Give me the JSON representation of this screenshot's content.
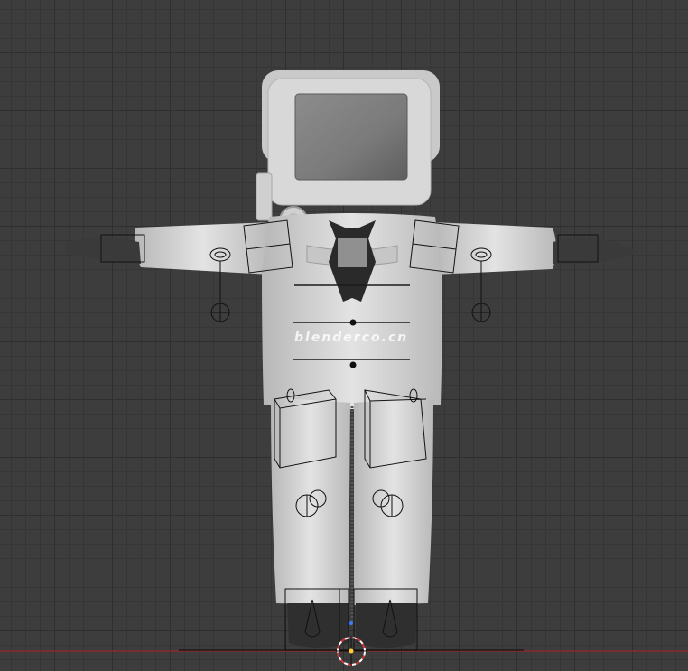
{
  "viewport": {
    "watermark_text": "blenderco.cn",
    "background_color": "#3d3d3d",
    "grid_color": "#2f2f2f",
    "axis_x_color": "#8a2a2a"
  },
  "character": {
    "body_color": "#d8d8d8",
    "shade_color": "#a9a9a9",
    "screen_color": "#808080",
    "tie_color": "#2a2a2a",
    "glove_color": "#3a3a3a"
  },
  "overlays": {
    "rig_wire_color": "#111111",
    "origin_cursor": "3d-cursor-icon"
  }
}
